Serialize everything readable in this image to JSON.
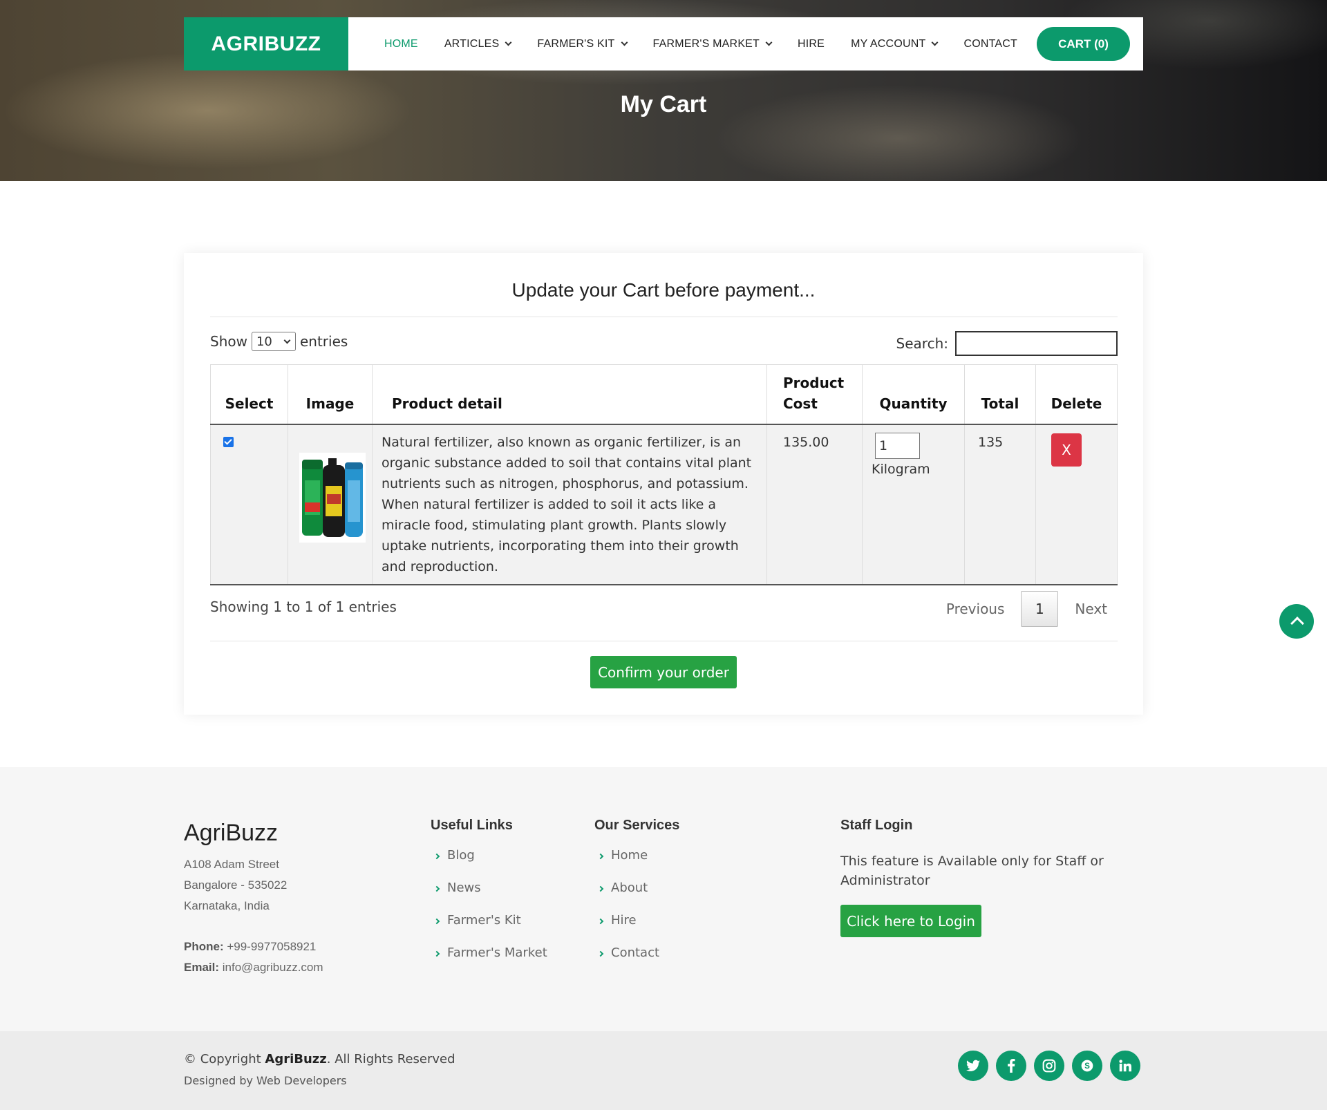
{
  "header": {
    "brand": "AGRIBUZZ",
    "nav": [
      {
        "label": "HOME",
        "active": true
      },
      {
        "label": "ARTICLES",
        "dropdown": true
      },
      {
        "label": "FARMER'S KIT",
        "dropdown": true
      },
      {
        "label": "FARMER'S MARKET",
        "dropdown": true
      },
      {
        "label": "HIRE"
      },
      {
        "label": "MY ACCOUNT",
        "dropdown": true
      },
      {
        "label": "CONTACT"
      }
    ],
    "cart_label": "CART (0)",
    "page_title": "My Cart"
  },
  "cart": {
    "heading": "Update your Cart before payment...",
    "show_label": "Show",
    "entries_value": "10",
    "entries_label": "entries",
    "search_label": "Search:",
    "search_value": "",
    "columns": [
      "Select",
      "Image",
      "Product detail",
      "Product Cost",
      "Quantity",
      "Total",
      "Delete"
    ],
    "rows": [
      {
        "selected": true,
        "detail": " Natural fertilizer, also known as organic fertilizer, is an organic substance added to soil that contains vital plant nutrients such as nitrogen, phosphorus, and potassium. When natural fertilizer is added to soil it acts like a miracle food, stimulating plant growth. Plants slowly uptake nutrients, incorporating them into their growth and reproduction.",
        "cost": "135.00",
        "quantity": "1",
        "unit": "Kilogram",
        "total": "135",
        "delete_label": "X"
      }
    ],
    "info": "Showing 1 to 1 of 1 entries",
    "pager": {
      "previous": "Previous",
      "page": "1",
      "next": "Next"
    },
    "confirm_label": "Confirm your order"
  },
  "footer": {
    "brand": "AgriBuzz",
    "address": [
      "A108 Adam Street",
      "Bangalore - 535022",
      "Karnataka, India"
    ],
    "phone_label": "Phone:",
    "phone": "+99-9977058921",
    "email_label": "Email:",
    "email": "info@agribuzz.com",
    "useful_links_title": "Useful Links",
    "useful_links": [
      "Blog",
      "News",
      "Farmer's Kit",
      "Farmer's Market"
    ],
    "services_title": "Our Services",
    "services": [
      "Home",
      "About",
      "Hire",
      "Contact"
    ],
    "staff_title": "Staff Login",
    "staff_text": "This feature is Available only for Staff or Administrator",
    "login_label": "Click here to Login",
    "copyright_prefix": "© Copyright ",
    "copyright_brand": "AgriBuzz",
    "copyright_suffix": ". All Rights Reserved",
    "designed_by": "Designed by Web Developers",
    "socials": [
      "twitter-icon",
      "facebook-icon",
      "instagram-icon",
      "skype-icon",
      "linkedin-icon"
    ]
  },
  "colors": {
    "brand": "#0c9a6c",
    "button_green": "#27a243",
    "delete_red": "#dc3545"
  }
}
